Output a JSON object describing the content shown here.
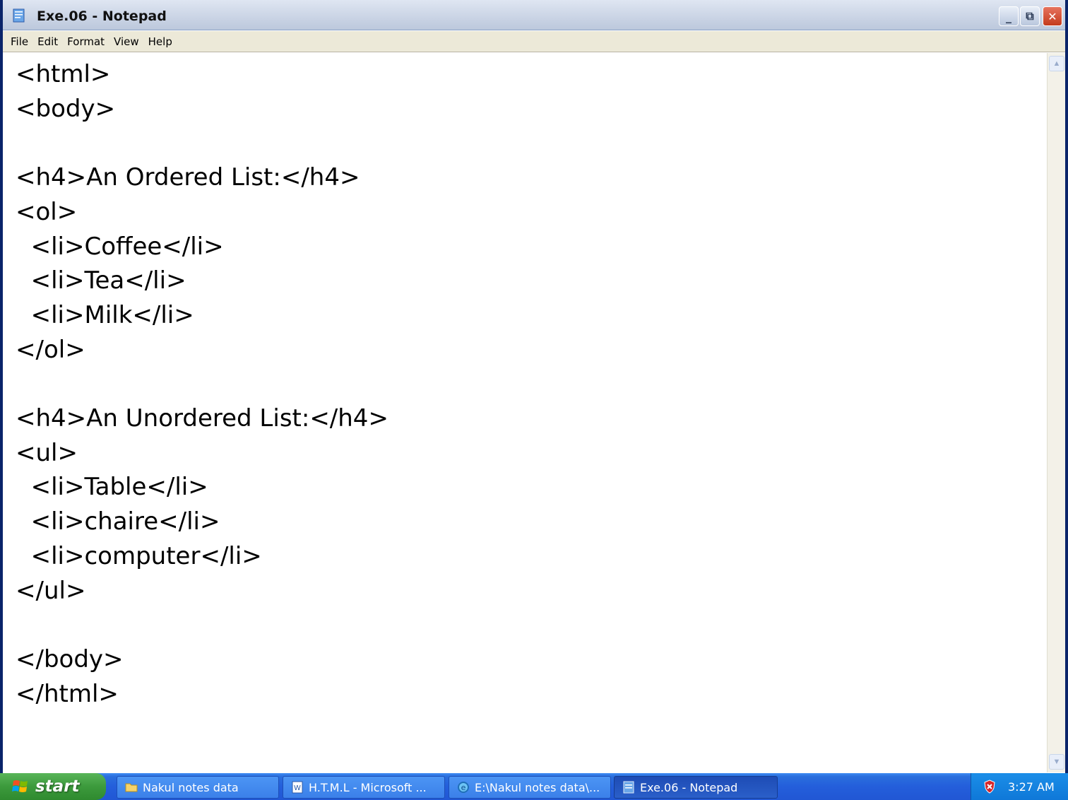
{
  "window": {
    "title": "Exe.06 - Notepad",
    "controls": {
      "minimize": "_",
      "maximize": "⧉",
      "close": "✕"
    }
  },
  "menu": {
    "items": [
      "File",
      "Edit",
      "Format",
      "View",
      "Help"
    ]
  },
  "editor": {
    "content": "<html>\n<body>\n\n<h4>An Ordered List:</h4>\n<ol>\n  <li>Coffee</li>\n  <li>Tea</li>\n  <li>Milk</li>\n</ol>\n\n<h4>An Unordered List:</h4>\n<ul>\n  <li>Table</li>\n  <li>chaire</li>\n  <li>computer</li>\n</ul>\n\n</body>\n</html>"
  },
  "taskbar": {
    "start_label": "start",
    "tasks": [
      {
        "label": "Nakul notes data",
        "icon": "folder-icon",
        "active": false
      },
      {
        "label": "H.T.M.L - Microsoft ...",
        "icon": "word-document-icon",
        "active": false
      },
      {
        "label": "E:\\Nakul notes data\\...",
        "icon": "internet-explorer-icon",
        "active": false
      },
      {
        "label": "Exe.06 - Notepad",
        "icon": "notepad-icon",
        "active": true
      }
    ],
    "clock": "3:27 AM",
    "tray_icon": "security-shield-icon"
  },
  "colors": {
    "taskbar_blue": "#245edb",
    "start_green": "#3c9a3c",
    "window_border": "#0a246a",
    "close_red": "#c43b1c"
  }
}
